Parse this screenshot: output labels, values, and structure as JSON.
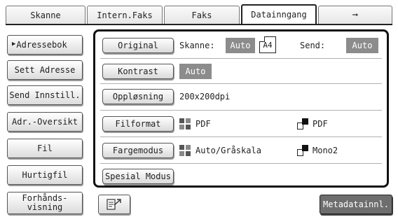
{
  "tabs": [
    {
      "label": "Skanne"
    },
    {
      "label": "Intern.Faks"
    },
    {
      "label": "Faks"
    },
    {
      "label": "Datainngang"
    },
    {
      "label": "➞"
    }
  ],
  "sidebar": {
    "items": [
      {
        "label": "Adressebok"
      },
      {
        "label": "Sett Adresse"
      },
      {
        "label": "Send Innstill."
      },
      {
        "label": "Adr.-Oversikt"
      },
      {
        "label": "Fil"
      },
      {
        "label": "Hurtigfil"
      },
      {
        "label": "Forhånds-\nvisning"
      }
    ]
  },
  "options": {
    "original": {
      "label": "Original",
      "scan_label": "Skanne:",
      "scan_value": "Auto",
      "paper_size": "A4",
      "send_label": "Send:",
      "send_value": "Auto"
    },
    "contrast": {
      "label": "Kontrast",
      "value": "Auto"
    },
    "resolution": {
      "label": "Oppløsning",
      "value": "200x200dpi"
    },
    "file_format": {
      "label": "Filformat",
      "color_value": "PDF",
      "mono_value": "PDF"
    },
    "color_mode": {
      "label": "Fargemodus",
      "color_value": "Auto/Gråskala",
      "mono_value": "Mono2"
    },
    "special_mode": {
      "label": "Spesial Modus"
    }
  },
  "footer": {
    "metadata_label": "Metadatainnl."
  },
  "colors": {
    "badge_gray": "#8c8c8c",
    "meta_button": "#6e6e6e",
    "panel_border": "#111111"
  }
}
